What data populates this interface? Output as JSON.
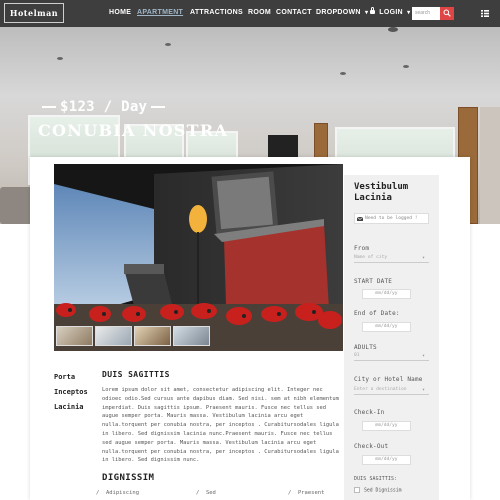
{
  "header": {
    "logo": "Hotelman",
    "nav": [
      "HOME",
      "APARTMENT",
      "ATTRACTIONS",
      "ROOM",
      "CONTACT",
      "DROPDOWN",
      "LOGIN"
    ],
    "active_nav": "APARTMENT",
    "search_placeholder": "search",
    "search_icon": "search-icon",
    "menu_icon": "grid-menu-icon"
  },
  "hero": {
    "price": "$123 / Day",
    "title": "CONUBIA NOSTRA"
  },
  "content": {
    "left_nav": [
      "Porta",
      "Inceptos",
      "Lacinia"
    ],
    "section_title": "DUIS SAGITTIS",
    "body": "Lorem ipsum dolor sit amet, consectetur adipiscing elit. Integer nec odioec odio.Sed cursus ante dapibus diam. Sed nisi. sem at nibh elementum imperdiat. Duis sagittis ipsum. Praesent mauris. Fusce nec tellus sed augue semper porta. Mauris massa. Vestibulum lacinia arcu eget nulla.torquent per conubia nostra, per inceptos . Curabitursodales ligula in libero. Sed dignissim lacinia nunc.Praesent mauris. Fusce nec tellus sed augue semper porta. Mauris massa. Vestibulum lacinia arcu eget nulla.torquent per conubia nostra, per inceptos . Curabitursodales ligula in libero. Sed dignissim nunc.",
    "section2_title": "DIGNISSIM",
    "amenities": [
      "Adipiscing",
      "Sed",
      "Praesent"
    ]
  },
  "sidebar": {
    "title": "Vestibulum Lacinia",
    "login_notice": "Need to be logged !",
    "from_label": "From",
    "from_placeholder": "Name of city",
    "start_date_label": "START DATE",
    "start_date_placeholder": "mm/dd/yy",
    "end_date_label": "End of Date:",
    "end_date_placeholder": "mm/dd/yy",
    "adults_label": "ADULTS",
    "adults_value": "01",
    "city_label": "City or Hotel Name",
    "city_placeholder": "Enter a destination",
    "checkin_label": "Check-In",
    "checkin_placeholder": "mm/dd/yy",
    "checkout_label": "Check-Out",
    "checkout_placeholder": "mm/dd/yy",
    "sagittis_label": "DUIS SAGITTIS:",
    "checkbox_1": "Sed Dignissim"
  },
  "colors": {
    "nav_bg": "#3e3e3e",
    "accent": "#e04545",
    "active_nav": "#9fb6c8",
    "sidebar_bg": "#f0f0f0"
  }
}
